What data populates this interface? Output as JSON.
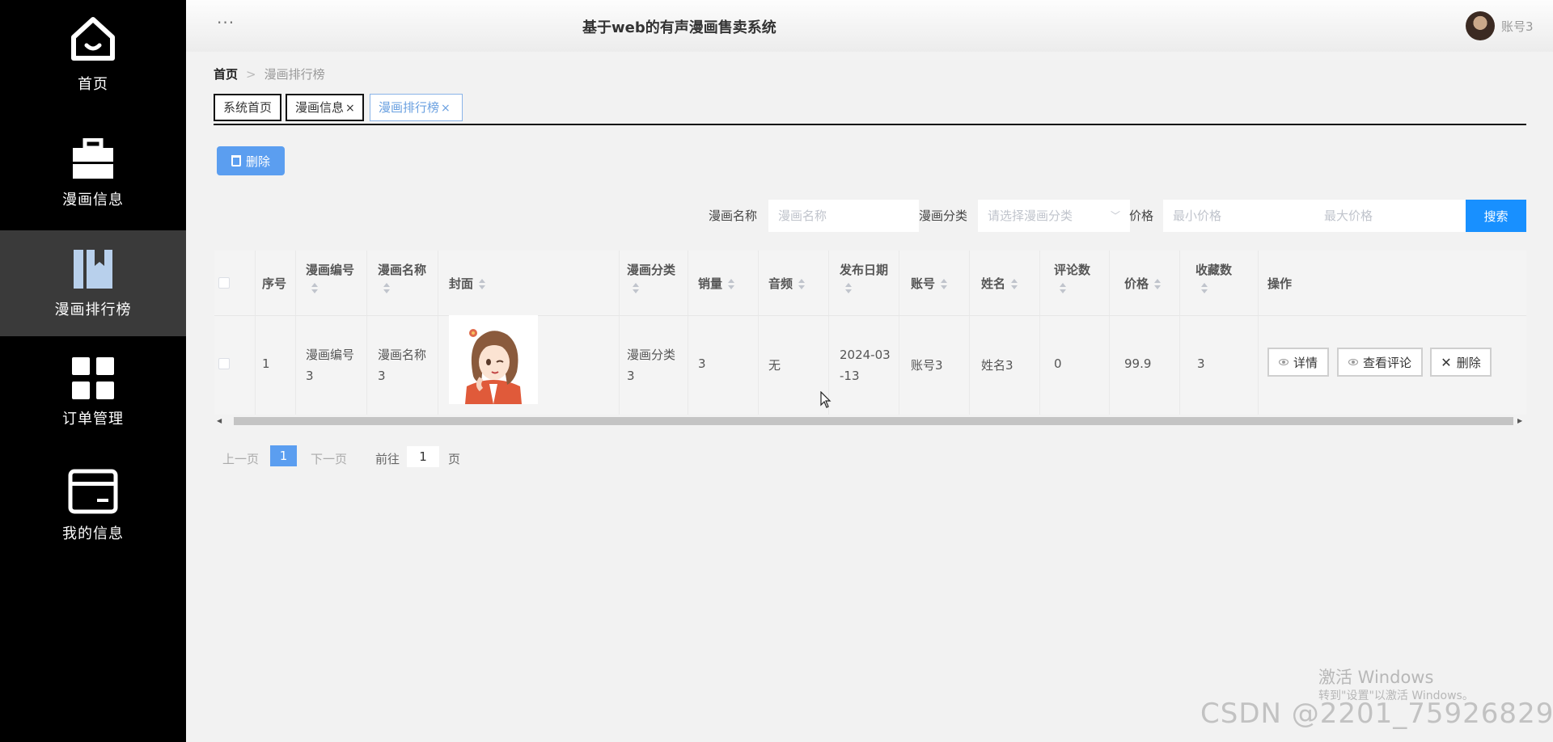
{
  "sidebar": {
    "items": [
      {
        "label": "首页",
        "icon": "home-icon",
        "active": false
      },
      {
        "label": "漫画信息",
        "icon": "briefcase-icon",
        "active": false
      },
      {
        "label": "漫画排行榜",
        "icon": "bookmark-icon",
        "active": true
      },
      {
        "label": "订单管理",
        "icon": "grid-icon",
        "active": false
      },
      {
        "label": "我的信息",
        "icon": "card-icon",
        "active": false
      }
    ]
  },
  "header": {
    "menu_dots": "···",
    "title": "基于web的有声漫画售卖系统",
    "account": "账号3"
  },
  "breadcrumb": {
    "home": "首页",
    "separator": ">",
    "current": "漫画排行榜"
  },
  "tabs": [
    {
      "label": "系统首页",
      "closable": false
    },
    {
      "label": "漫画信息",
      "closable": true
    },
    {
      "label": "漫画排行榜",
      "closable": true,
      "active": true
    }
  ],
  "tab_close_symbol": "×",
  "toolbar": {
    "delete_label": "删除"
  },
  "search": {
    "name_label": "漫画名称",
    "name_placeholder": "漫画名称",
    "category_label": "漫画分类",
    "category_placeholder": "请选择漫画分类",
    "price_label": "价格",
    "min_price_placeholder": "最小价格",
    "max_price_placeholder": "最大价格",
    "search_label": "搜索"
  },
  "table": {
    "headers": {
      "index": "序号",
      "code": "漫画编号",
      "name": "漫画名称",
      "cover": "封面",
      "category": "漫画分类",
      "sales": "销量",
      "audio": "音频",
      "date": "发布日期",
      "account": "账号",
      "username": "姓名",
      "comments": "评论数",
      "price": "价格",
      "favorites": "收藏数",
      "actions": "操作"
    },
    "rows": [
      {
        "index": "1",
        "code_line1": "漫画编号",
        "code_line2": "3",
        "name_line1": "漫画名称",
        "name_line2": "3",
        "category_line1": "漫画分类",
        "category_line2": "3",
        "sales": "3",
        "audio": "无",
        "date_line1": "2024-03",
        "date_line2": "-13",
        "account": "账号3",
        "username": "姓名3",
        "comments": "0",
        "price": "99.9",
        "favorites": "3"
      }
    ],
    "actions": {
      "detail": "详情",
      "view_comments": "查看评论",
      "delete": "删除"
    }
  },
  "pagination": {
    "prev": "上一页",
    "current_page": "1",
    "next": "下一页",
    "goto_prefix": "前往",
    "goto_value": "1",
    "goto_suffix": "页"
  },
  "watermark": {
    "activate_title": "激活 Windows",
    "activate_sub": "转到\"设置\"以激活 Windows。",
    "csdn": "CSDN @2201_75926829"
  },
  "colors": {
    "sidebar_bg": "#000000",
    "sidebar_active": "#3a3a3a",
    "primary_blue": "#1890ff",
    "light_blue": "#5b9ef0",
    "page_bg": "#f2f2f2"
  }
}
